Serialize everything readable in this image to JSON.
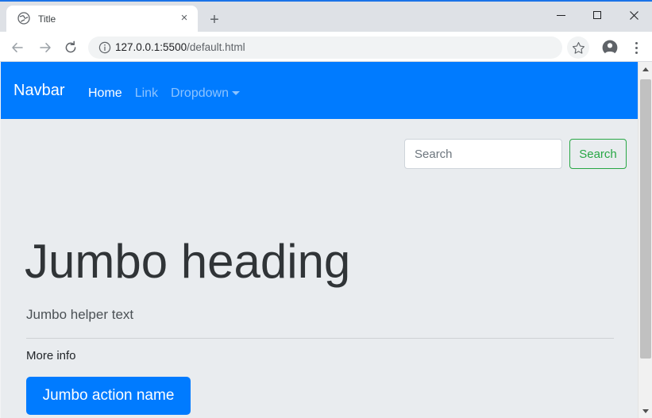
{
  "browser": {
    "tab": {
      "title": "Title",
      "favicon": "globe-icon",
      "close_label": "×"
    },
    "new_tab_label": "+",
    "window_controls": {
      "minimize": "minimize-icon",
      "maximize": "maximize-icon",
      "close": "✕"
    },
    "toolbar": {
      "back": "back-arrow-icon",
      "forward": "forward-arrow-icon",
      "reload": "reload-icon",
      "site_info": "info-circle-icon",
      "url_host": "127.0.0.1:5500",
      "url_path": "/default.html",
      "bookmark": "star-icon",
      "profile": "profile-avatar-icon",
      "menu": "three-dot-menu-icon"
    }
  },
  "page": {
    "navbar": {
      "brand": "Navbar",
      "links": [
        {
          "label": "Home",
          "active": true
        },
        {
          "label": "Link",
          "active": false
        },
        {
          "label": "Dropdown",
          "active": false,
          "has_caret": true
        }
      ],
      "search": {
        "value": "",
        "placeholder": "Search",
        "button_label": "Search"
      }
    },
    "jumbotron": {
      "heading": "Jumbo heading",
      "lead": "Jumbo helper text",
      "info": "More info",
      "action_label": "Jumbo action name"
    },
    "scrollbar": {
      "up_arrow": "scroll-up-arrow",
      "down_arrow": "scroll-down-arrow"
    }
  },
  "colors": {
    "navbar_blue": "#007bff",
    "success_green": "#28a745",
    "jumbotron_bg": "#e9ecef",
    "browser_chrome": "#dee1e6"
  }
}
